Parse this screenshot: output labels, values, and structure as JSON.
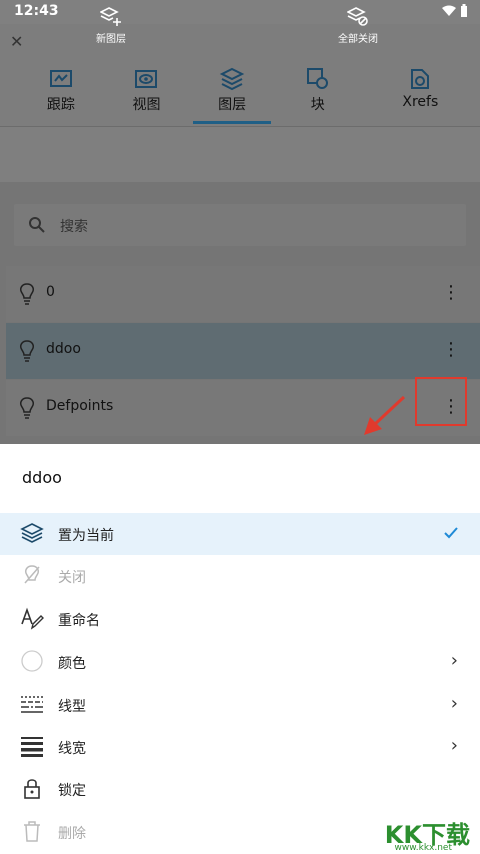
{
  "status_bar": {
    "time": "12:43",
    "icons": [
      "wifi-icon",
      "battery-icon"
    ]
  },
  "header": {
    "close_icon": "close-icon"
  },
  "tabs": [
    {
      "label": "跟踪",
      "icon": "track-icon",
      "active": false
    },
    {
      "label": "视图",
      "icon": "view-icon",
      "active": false
    },
    {
      "label": "图层",
      "icon": "layers-icon",
      "active": true
    },
    {
      "label": "块",
      "icon": "block-icon",
      "active": false
    },
    {
      "label": "Xrefs",
      "icon": "xrefs-icon",
      "active": false
    }
  ],
  "toolbar": {
    "new_layer": "新图层",
    "close_all": "全部关闭"
  },
  "search": {
    "placeholder": "搜索"
  },
  "layers": [
    {
      "name": "0"
    },
    {
      "name": "ddoo"
    },
    {
      "name": "Defpoints"
    }
  ],
  "sheet": {
    "title": "ddoo",
    "items": [
      {
        "label": "置为当前",
        "icon": "layers-current-icon",
        "selected": true
      },
      {
        "label": "关闭",
        "icon": "bulb-off-icon",
        "disabled": true
      },
      {
        "label": "重命名",
        "icon": "rename-icon"
      },
      {
        "label": "颜色",
        "icon": "color-circle-icon",
        "chevron": true
      },
      {
        "label": "线型",
        "icon": "linetype-icon",
        "chevron": true
      },
      {
        "label": "线宽",
        "icon": "lineweight-icon",
        "chevron": true
      },
      {
        "label": "锁定",
        "icon": "lock-icon"
      },
      {
        "label": "删除",
        "icon": "trash-icon",
        "disabled": true
      }
    ]
  },
  "watermark": {
    "text": "KK下载",
    "url": "www.kkx.net"
  },
  "colors": {
    "accent": "#1f5f86",
    "check": "#1f8ad6",
    "highlight": "#e03a2d"
  }
}
